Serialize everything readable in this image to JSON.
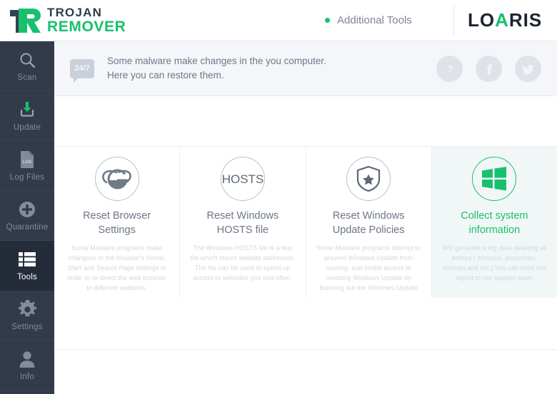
{
  "header": {
    "brand_line1": "TROJAN",
    "brand_line2": "REMOVER",
    "brand_mark_icon": "trojan-remover-logo-icon",
    "additional_tools_label": "Additional Tools",
    "status_dot_icon": "green-status-dot-icon",
    "company_part1": "LO",
    "company_part2": "A",
    "company_part3": "RIS",
    "accent_green": "#18c06e",
    "dark_navy": "#2f3b4a"
  },
  "sidebar": {
    "items": [
      {
        "label": "Scan",
        "icon": "magnifier-icon",
        "active": false
      },
      {
        "label": "Update",
        "icon": "download-arrow-icon",
        "active": false
      },
      {
        "label": "Log Files",
        "icon": "log-document-icon",
        "active": false
      },
      {
        "label": "Quarantine",
        "icon": "plus-circle-icon",
        "active": false
      },
      {
        "label": "Tools",
        "icon": "list-grid-icon",
        "active": true
      },
      {
        "label": "Settings",
        "icon": "gear-icon",
        "active": false
      },
      {
        "label": "Info",
        "icon": "person-icon",
        "active": false
      }
    ],
    "background": "#333b4b",
    "active_background": "#252c39"
  },
  "notice": {
    "badge_text": "24/7",
    "badge_icon": "speech-bubble-icon",
    "line1": "Some malware make changes in the you computer.",
    "line2": "Here you can restore them.",
    "actions": [
      {
        "icon": "help-question-icon",
        "glyph": "?",
        "name": "help-button"
      },
      {
        "icon": "facebook-icon",
        "glyph": "f",
        "name": "facebook-button"
      },
      {
        "icon": "twitter-icon",
        "glyph": "t",
        "name": "twitter-button"
      }
    ]
  },
  "tools": {
    "cards": [
      {
        "icon": "internet-explorer-icon",
        "title_line1": "Reset Browser",
        "title_line2": "Settings",
        "description": "Some Malware programs make changess to the browser's Home, Start and Search Page settings in order to re-direct the web browser to different websites.",
        "highlighted": false
      },
      {
        "icon": "hosts-file-icon",
        "icon_text": "HOSTS",
        "title_line1": "Reset Windows",
        "title_line2": "HOSTS file",
        "description": "The Windows HOSTS file is a text file which stores website addresses. The file can be used to speed up access to websites you visit often.",
        "highlighted": false
      },
      {
        "icon": "shield-star-icon",
        "title_line1": "Reset Windows",
        "title_line2": "Update Policies",
        "description": "Some Malware programs attempt to prevent Windows Update from running, and inhibit access to resetting Windows Update by blanking out the Windows Update",
        "highlighted": false
      },
      {
        "icon": "windows-logo-icon",
        "title_line1": "Collect system",
        "title_line2": "information",
        "description": "Will generate a log data detailing all entries ( services, processes, startups and etc.) You can send this report to our support team",
        "highlighted": true
      }
    ]
  }
}
